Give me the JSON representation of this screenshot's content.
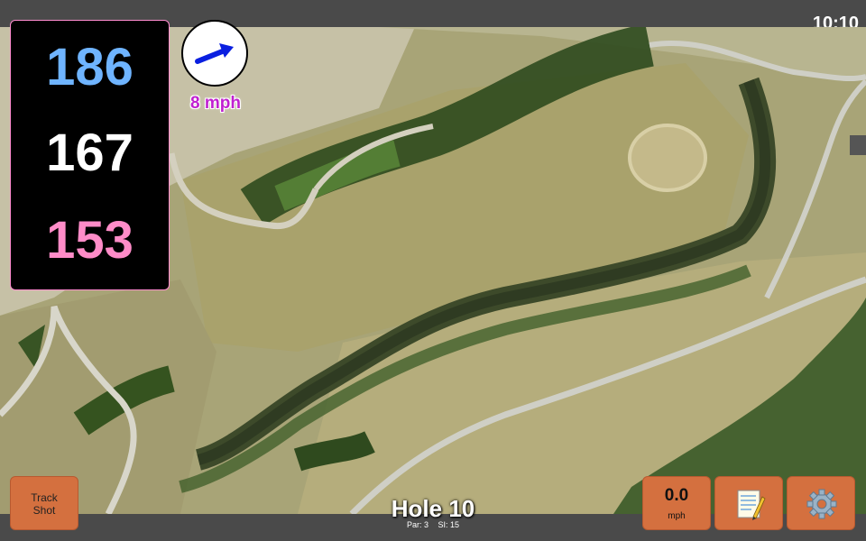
{
  "status": {
    "time": "10:10"
  },
  "yardage": {
    "back": "186",
    "middle": "167",
    "front": "153"
  },
  "wind": {
    "speed": "8 mph",
    "icon": "wind-direction-arrow-icon"
  },
  "hole": {
    "title": "Hole 10",
    "par": "Par: 3",
    "si": "SI: 15"
  },
  "buttons": {
    "track_shot_line1": "Track",
    "track_shot_line2": "Shot",
    "speed_value": "0.0",
    "speed_unit": "mph",
    "notes_icon": "notepad-icon",
    "settings_icon": "gear-icon"
  },
  "colors": {
    "back": "#6fb4ff",
    "middle": "#ffffff",
    "front": "#ff8cc8",
    "button": "#d4703f",
    "wind_text": "#c020d0",
    "arrow": "#0a1fe0"
  }
}
